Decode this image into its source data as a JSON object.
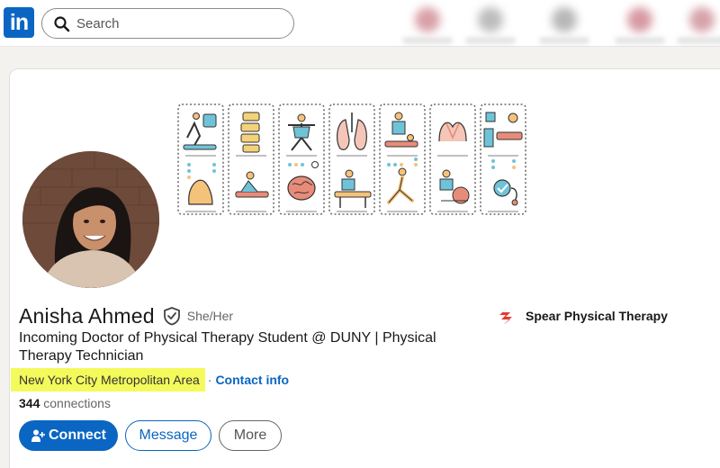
{
  "app": {
    "logo_text": "in"
  },
  "search": {
    "placeholder": "Search",
    "icon": "search-icon"
  },
  "profile": {
    "name": "Anisha Ahmed",
    "pronouns": "She/Her",
    "headline": "Incoming Doctor of Physical Therapy Student @ DUNY | Physical Therapy Technician",
    "location": "New York City Metropolitan Area",
    "separator": "·",
    "contact_info": "Contact info",
    "connections_count": "344",
    "connections_label": "connections",
    "verified_icon": "shield-check-icon"
  },
  "actions": {
    "connect": "Connect",
    "message": "Message",
    "more": "More"
  },
  "experience": {
    "company": "Spear Physical Therapy"
  },
  "colors": {
    "brand": "#0a66c2",
    "highlight": "#f4fa5b",
    "company_red": "#e03a2e"
  }
}
